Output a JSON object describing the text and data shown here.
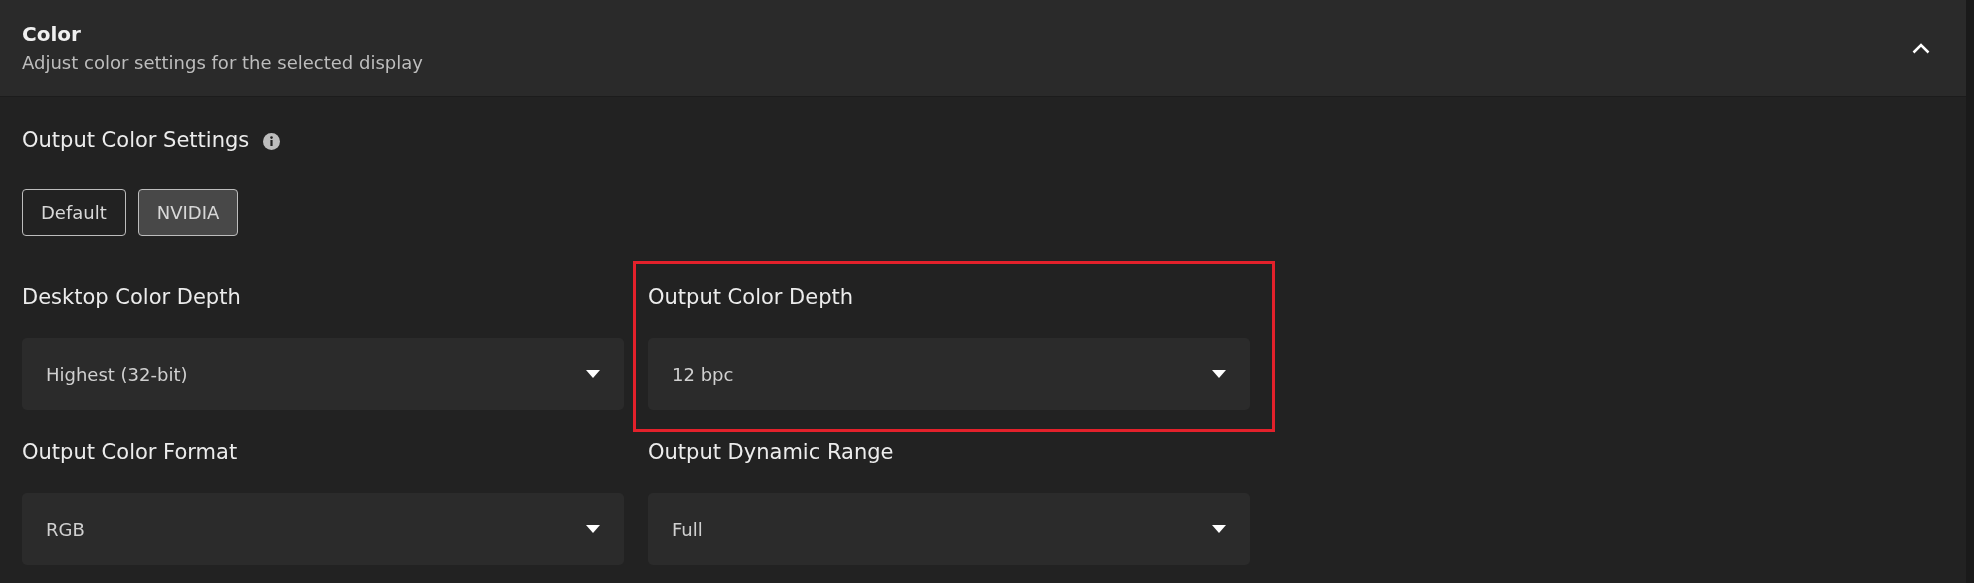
{
  "section": {
    "title": "Color",
    "subtitle": "Adjust color settings for the selected display",
    "expanded": true
  },
  "output_color_settings": {
    "label": "Output Color Settings",
    "options": [
      {
        "label": "Default",
        "selected": false
      },
      {
        "label": "NVIDIA",
        "selected": true
      }
    ]
  },
  "fields": [
    {
      "label": "Desktop Color Depth",
      "value": "Highest (32-bit)",
      "highlighted": false
    },
    {
      "label": "Output Color Depth",
      "value": "12 bpc",
      "highlighted": true
    },
    {
      "label": "Output Color Format",
      "value": "RGB",
      "highlighted": false
    },
    {
      "label": "Output Dynamic Range",
      "value": "Full",
      "highlighted": false
    }
  ]
}
